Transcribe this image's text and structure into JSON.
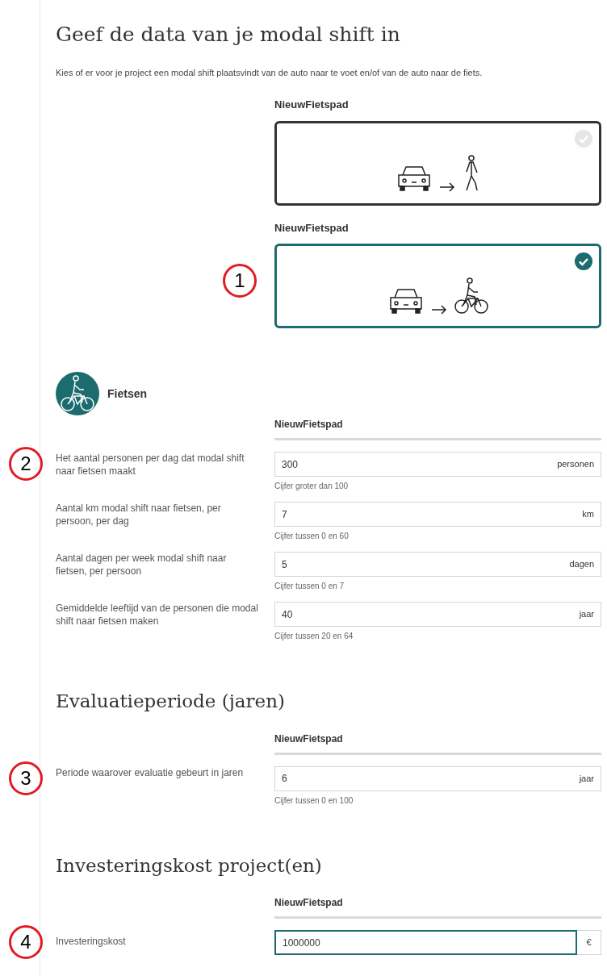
{
  "title": "Geef de data van je modal shift in",
  "intro": "Kies of er voor je project een modal shift plaatsvindt van de auto naar te voet en/of van de auto naar de fiets.",
  "options": [
    {
      "label": "NieuwFietspad",
      "kind": "walk",
      "selected": false
    },
    {
      "label": "NieuwFietspad",
      "kind": "bike",
      "selected": true,
      "marker": "1"
    }
  ],
  "mode": {
    "name": "Fietsen"
  },
  "sections": [
    {
      "column_header": "NieuwFietspad",
      "rows": [
        {
          "label": "Het aantal personen per dag dat modal shift naar fietsen maakt",
          "value": "300",
          "unit": "personen",
          "hint": "Cijfer groter dan 100",
          "kind": "inline",
          "focused": false,
          "marker": "2"
        },
        {
          "label": "Aantal km modal shift naar fietsen, per persoon, per dag",
          "value": "7",
          "unit": "km",
          "hint": "Cijfer tussen 0 en 60",
          "kind": "inline",
          "focused": false
        },
        {
          "label": "Aantal dagen per week modal shift naar fietsen, per persoon",
          "value": "5",
          "unit": "dagen",
          "hint": "Cijfer tussen 0 en 7",
          "kind": "inline",
          "focused": false
        },
        {
          "label": "Gemiddelde leeftijd van de personen die modal shift naar fietsen maken",
          "value": "40",
          "unit": "jaar",
          "hint": "Cijfer tussen 20 en 64",
          "kind": "inline",
          "focused": false
        }
      ]
    },
    {
      "heading": "Evaluatieperiode (jaren)",
      "column_header": "NieuwFietspad",
      "rows": [
        {
          "label": "Periode waarover evaluatie gebeurt in jaren",
          "value": "6",
          "unit": "jaar",
          "hint": "Cijfer tussen 0 en 100",
          "kind": "inline",
          "focused": false,
          "marker": "3"
        }
      ]
    },
    {
      "heading": "Investeringskost project(en)",
      "column_header": "NieuwFietspad",
      "rows": [
        {
          "label": "Investeringskost",
          "value": "1000000",
          "unit": "€",
          "kind": "addon",
          "focused": true,
          "marker": "4"
        }
      ]
    }
  ]
}
